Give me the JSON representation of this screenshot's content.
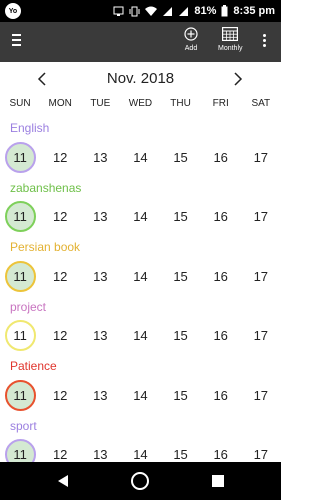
{
  "status_bar": {
    "app_badge": "Yo",
    "battery": "81%",
    "time": "8:35 pm"
  },
  "toolbar": {
    "add_label": "Add",
    "monthly_label": "Monthly"
  },
  "calendar": {
    "month_title": "Nov. 2018",
    "weekdays": [
      "SUN",
      "MON",
      "TUE",
      "WED",
      "THU",
      "FRI",
      "SAT"
    ],
    "days": [
      "11",
      "12",
      "13",
      "14",
      "15",
      "16",
      "17"
    ],
    "rows": [
      {
        "label": "English",
        "color": "#9b7fe0",
        "ring": "#b9a1ec",
        "first_day_filled": true
      },
      {
        "label": "zabanshenas",
        "color": "#6fc04a",
        "ring": "#7ed05a",
        "first_day_filled": true
      },
      {
        "label": "Persian book",
        "color": "#e3b233",
        "ring": "#ecc43a",
        "first_day_filled": true
      },
      {
        "label": "project",
        "color": "#c874c0",
        "ring": "#f0e870",
        "first_day_filled": false
      },
      {
        "label": "Patience",
        "color": "#e0352d",
        "ring": "#e8522e",
        "first_day_filled": true
      },
      {
        "label": "sport",
        "color": "#9b7fe0",
        "ring": "#b9a1ec",
        "first_day_filled": true
      }
    ]
  },
  "icons": {
    "menu": "hamburger-icon",
    "add": "add-circle-icon",
    "monthly": "calendar-grid-icon",
    "more": "more-vertical-icon"
  }
}
